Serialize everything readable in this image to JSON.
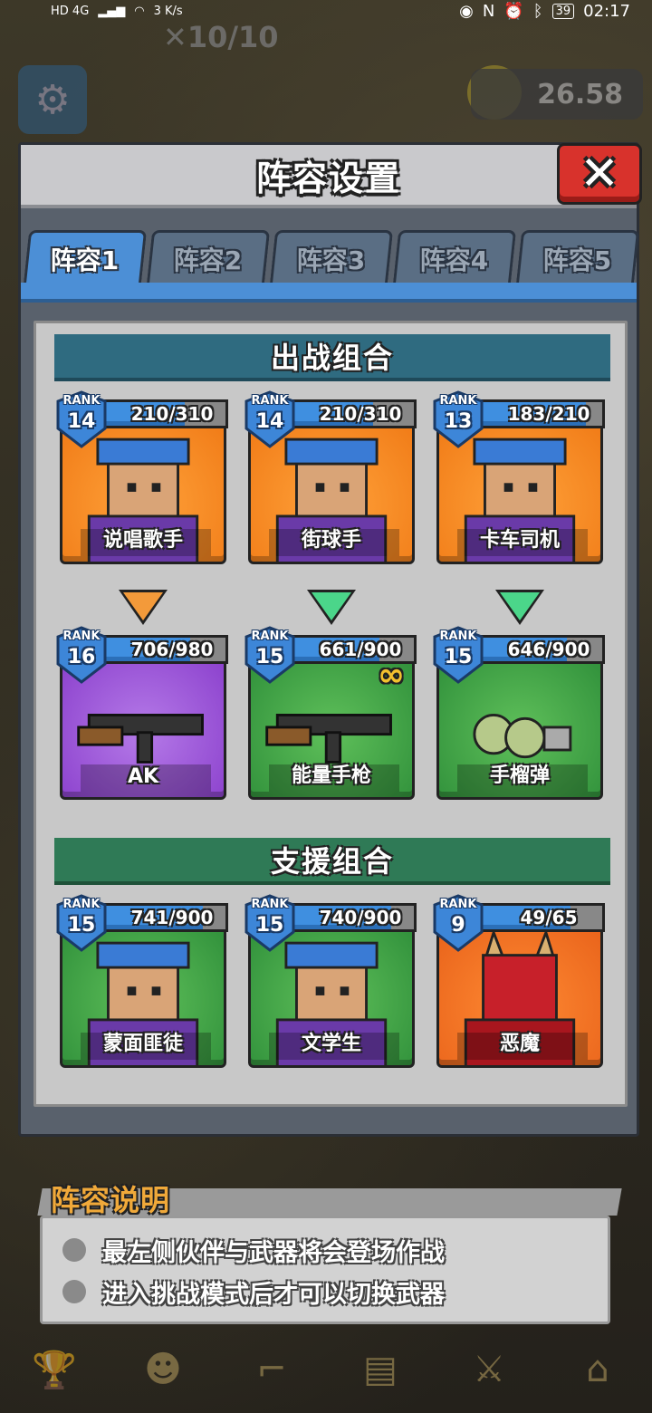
{
  "status_bar": {
    "network": "HD 4G",
    "speed": "3 K/s",
    "battery": "39",
    "time": "02:17"
  },
  "background": {
    "lives": "10/10",
    "coins": "26.58"
  },
  "modal": {
    "title": "阵容设置",
    "close_icon": "✕",
    "tabs": [
      {
        "label": "阵容1",
        "active": true
      },
      {
        "label": "阵容2",
        "active": false
      },
      {
        "label": "阵容3",
        "active": false
      },
      {
        "label": "阵容4",
        "active": false
      },
      {
        "label": "阵容5",
        "active": false
      }
    ],
    "battle_section": {
      "title": "出战组合",
      "characters": [
        {
          "name": "说唱歌手",
          "rank_label": "RANK",
          "rank": "14",
          "progress": "210/310",
          "fill": 0.68,
          "bg": "orange"
        },
        {
          "name": "街球手",
          "rank_label": "RANK",
          "rank": "14",
          "progress": "210/310",
          "fill": 0.68,
          "bg": "orange"
        },
        {
          "name": "卡车司机",
          "rank_label": "RANK",
          "rank": "13",
          "progress": "183/210",
          "fill": 0.87,
          "bg": "orange"
        }
      ],
      "arrows": [
        {
          "color": "#f39a3a"
        },
        {
          "color": "#4bd68a"
        },
        {
          "color": "#4bd68a"
        }
      ],
      "weapons": [
        {
          "name": "AK",
          "rank_label": "RANK",
          "rank": "16",
          "progress": "706/980",
          "fill": 0.72,
          "bg": "purple"
        },
        {
          "name": "能量手枪",
          "rank_label": "RANK",
          "rank": "15",
          "progress": "661/900",
          "fill": 0.73,
          "bg": "green",
          "badge": "∞"
        },
        {
          "name": "手榴弹",
          "rank_label": "RANK",
          "rank": "15",
          "progress": "646/900",
          "fill": 0.72,
          "bg": "green"
        }
      ]
    },
    "support_section": {
      "title": "支援组合",
      "characters": [
        {
          "name": "蒙面匪徒",
          "rank_label": "RANK",
          "rank": "15",
          "progress": "741/900",
          "fill": 0.82,
          "bg": "green"
        },
        {
          "name": "文学生",
          "rank_label": "RANK",
          "rank": "15",
          "progress": "740/900",
          "fill": 0.82,
          "bg": "green"
        },
        {
          "name": "恶魔",
          "rank_label": "RANK",
          "rank": "9",
          "progress": "49/65",
          "fill": 0.75,
          "bg": "red-orange"
        }
      ]
    }
  },
  "explanation": {
    "title": "阵容说明",
    "lines": [
      "最左侧伙伴与武器将会登场作战",
      "进入挑战模式后才可以切换武器"
    ]
  },
  "colors": {
    "tab_active": "#4c8fd6",
    "battle_header": "#2f6b80",
    "support_header": "#2f7a56",
    "close_button": "#d8322c",
    "progress_fill": "#3f8fe0",
    "explain_title": "#f0a93a"
  }
}
